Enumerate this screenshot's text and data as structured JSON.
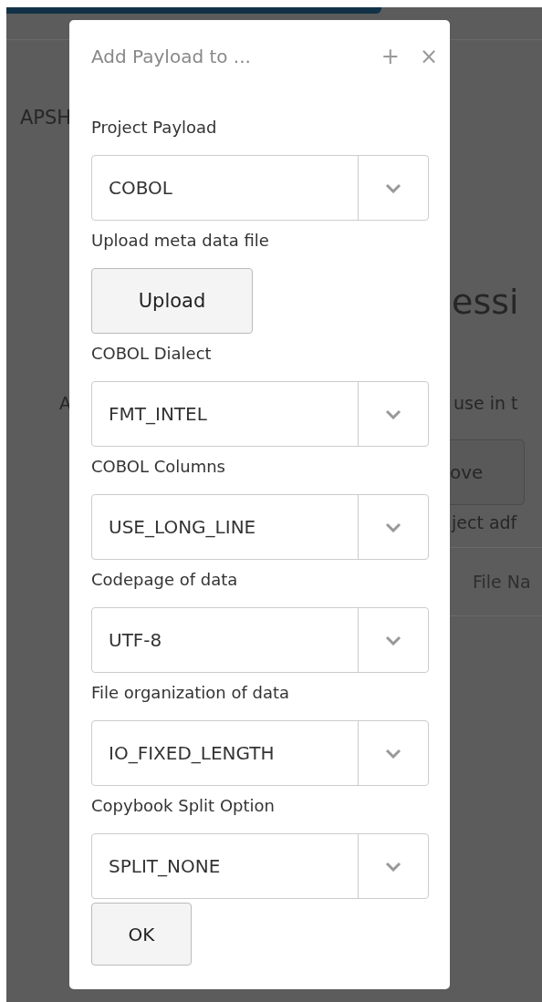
{
  "background": {
    "heading_fragment": "APSH",
    "title_fragment": "essi",
    "text_left_fragment": "A",
    "text_right_fragment": "use in t",
    "button_fragment": "ove",
    "note_fragment": "ject adf",
    "column_fragment": "File Na"
  },
  "dialog": {
    "title": "Add Payload to ...",
    "header_buttons": [
      "+",
      "×"
    ],
    "fields": [
      {
        "kind": "select",
        "label": "Project Payload",
        "value": "COBOL"
      },
      {
        "kind": "upload",
        "label": "Upload meta data file",
        "button": "Upload"
      },
      {
        "kind": "select",
        "label": "COBOL Dialect",
        "value": "FMT_INTEL"
      },
      {
        "kind": "select",
        "label": "COBOL Columns",
        "value": "USE_LONG_LINE"
      },
      {
        "kind": "select",
        "label": "Codepage of data",
        "value": "UTF-8"
      },
      {
        "kind": "select",
        "label": "File organization of data",
        "value": "IO_FIXED_LENGTH"
      },
      {
        "kind": "select",
        "label": "Copybook Split Option",
        "value": "SPLIT_NONE"
      }
    ],
    "ok": "OK"
  }
}
